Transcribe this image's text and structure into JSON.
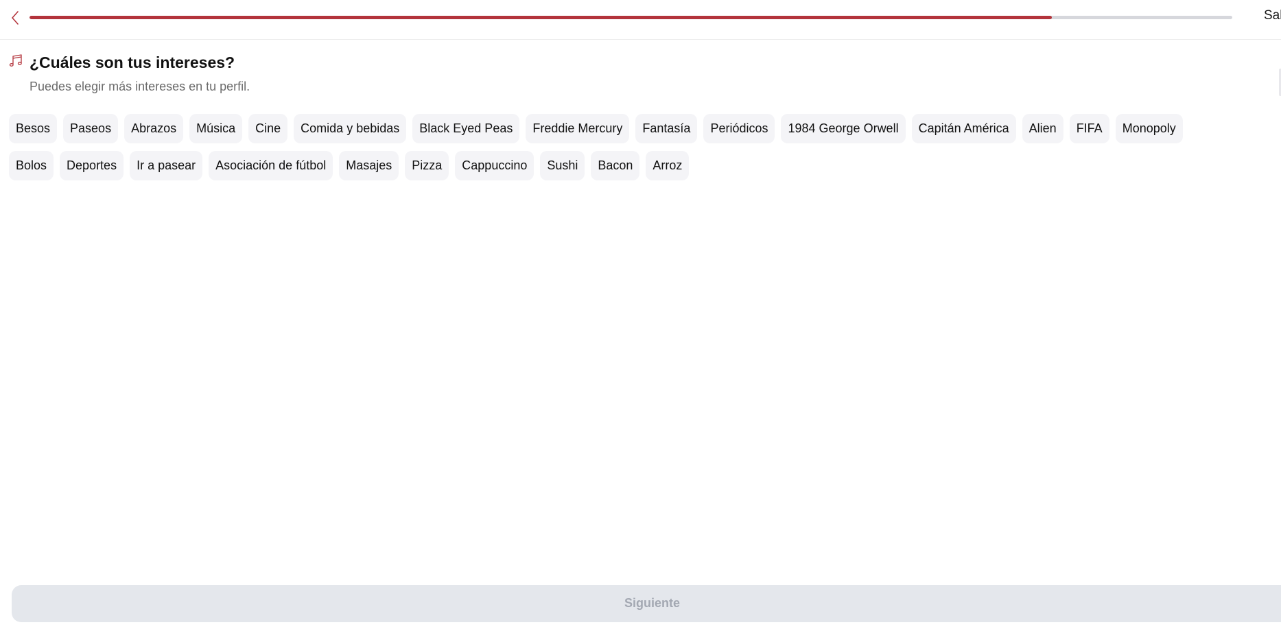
{
  "header": {
    "back_icon": "chevron-left-icon",
    "progress_fraction": 0.85,
    "progress_color": "#b3343c",
    "track_color": "#d6d7dc",
    "skip_label": "Sal"
  },
  "section": {
    "icon": "music-note-icon",
    "title": "¿Cuáles son tus intereses?",
    "subtitle": "Puedes elegir más intereses en tu perfil."
  },
  "interests": {
    "row1": [
      "Besos",
      "Paseos",
      "Abrazos",
      "Música",
      "Cine",
      "Comida y bebidas",
      "Black Eyed Peas",
      "Freddie Mercury",
      "Fantasía",
      "Periódicos",
      "1984 George Orwell",
      "Capitán América",
      "Alien",
      "FIFA",
      "Monopoly"
    ],
    "row2": [
      "Bolos",
      "Deportes",
      "Ir a pasear",
      "Asociación de fútbol",
      "Masajes",
      "Pizza",
      "Cappuccino",
      "Sushi",
      "Bacon",
      "Arroz"
    ]
  },
  "footer": {
    "next_label": "Siguiente"
  }
}
